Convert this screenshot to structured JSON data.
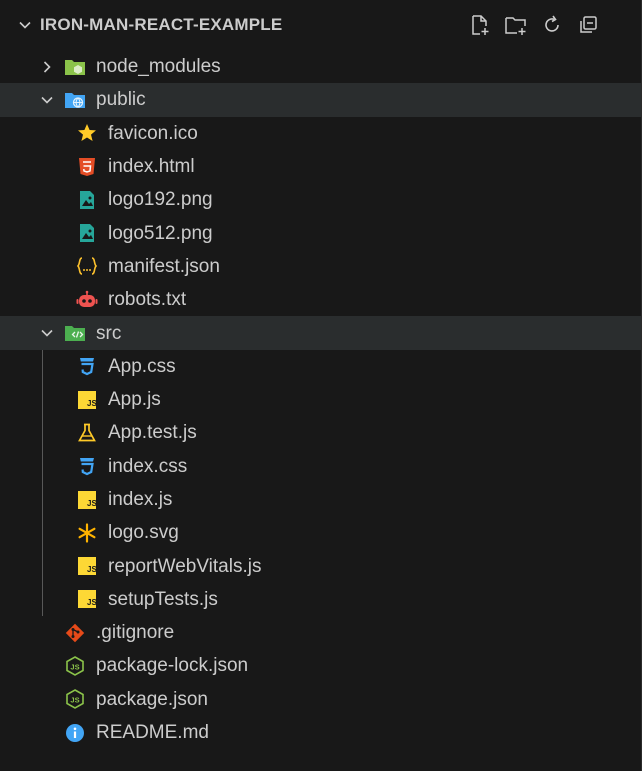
{
  "explorer": {
    "title": "IRON-MAN-REACT-EXAMPLE",
    "actions": [
      {
        "name": "new-file-icon"
      },
      {
        "name": "new-folder-icon"
      },
      {
        "name": "refresh-icon"
      },
      {
        "name": "collapse-all-icon"
      }
    ]
  },
  "tree": [
    {
      "label": "node_modules",
      "type": "folder",
      "state": "collapsed",
      "icon": "folder-node-icon"
    },
    {
      "label": "public",
      "type": "folder",
      "state": "expanded",
      "icon": "folder-public-icon",
      "selected": true,
      "children": [
        {
          "label": "favicon.ico",
          "icon": "star-icon"
        },
        {
          "label": "index.html",
          "icon": "html5-icon"
        },
        {
          "label": "logo192.png",
          "icon": "image-icon"
        },
        {
          "label": "logo512.png",
          "icon": "image-icon"
        },
        {
          "label": "manifest.json",
          "icon": "json-braces-icon"
        },
        {
          "label": "robots.txt",
          "icon": "robot-icon"
        }
      ]
    },
    {
      "label": "src",
      "type": "folder",
      "state": "expanded",
      "icon": "folder-src-icon",
      "selected": true,
      "children": [
        {
          "label": "App.css",
          "icon": "css3-icon"
        },
        {
          "label": "App.js",
          "icon": "js-icon"
        },
        {
          "label": "App.test.js",
          "icon": "flask-icon"
        },
        {
          "label": "index.css",
          "icon": "css3-icon"
        },
        {
          "label": "index.js",
          "icon": "js-icon"
        },
        {
          "label": "logo.svg",
          "icon": "svg-asterisk-icon"
        },
        {
          "label": "reportWebVitals.js",
          "icon": "js-icon"
        },
        {
          "label": "setupTests.js",
          "icon": "js-icon"
        }
      ]
    },
    {
      "label": ".gitignore",
      "type": "file",
      "icon": "git-icon"
    },
    {
      "label": "package-lock.json",
      "type": "file",
      "icon": "nodejs-icon"
    },
    {
      "label": "package.json",
      "type": "file",
      "icon": "nodejs-icon"
    },
    {
      "label": "README.md",
      "type": "file",
      "icon": "info-icon"
    }
  ],
  "colors": {
    "background": "#181818",
    "selected_row": "#2a2d2e",
    "text": "#cccccc",
    "node_folder": "#8bc34a",
    "public_folder": "#42a5f5",
    "src_folder": "#4caf50",
    "star": "#ffca28",
    "html": "#e44d26",
    "image": "#26a69a",
    "json": "#fbc02d",
    "robot": "#ef5350",
    "css": "#42a5f5",
    "js": "#fdd835",
    "flask": "#ffca28",
    "svg": "#ffb300",
    "git": "#e64a19",
    "node": "#8bc34a",
    "info": "#42a5f5"
  }
}
